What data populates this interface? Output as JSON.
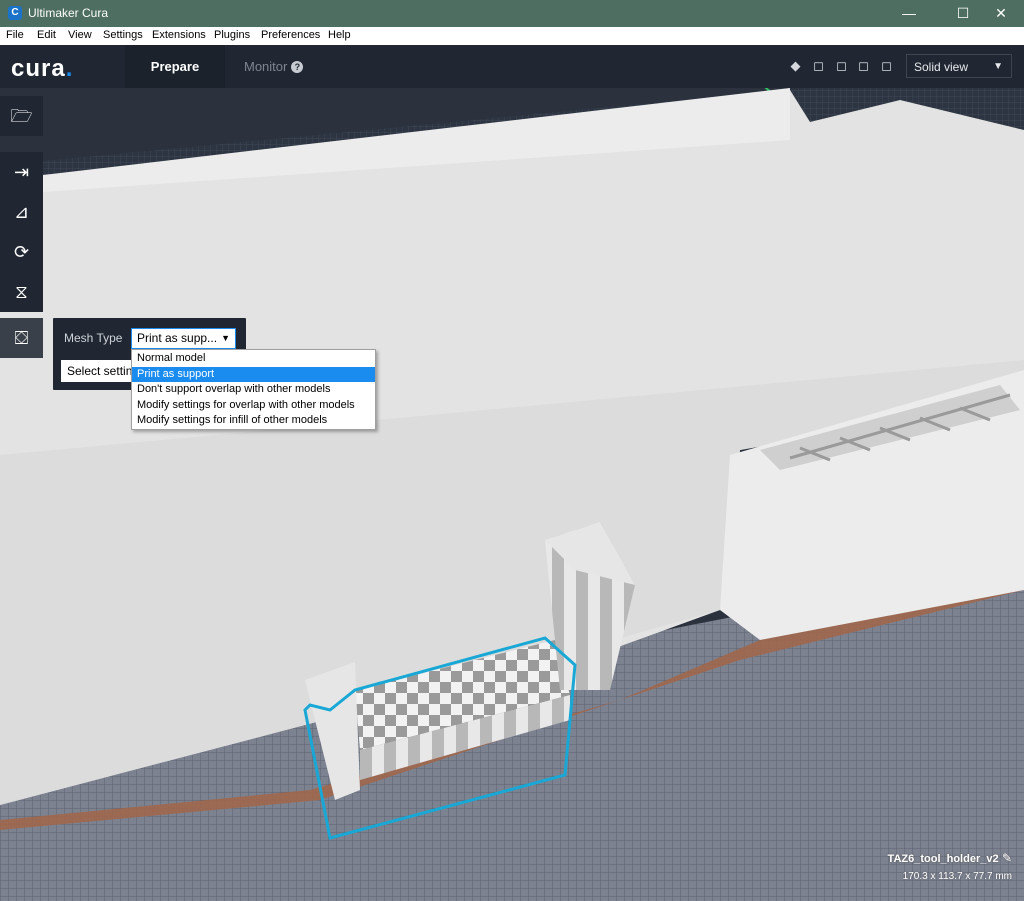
{
  "window": {
    "title": "Ultimaker Cura",
    "app_icon": "cura-app-icon",
    "minimize": "—",
    "maximize": "☐",
    "close": "✕"
  },
  "menu": [
    "File",
    "Edit",
    "View",
    "Settings",
    "Extensions",
    "Plugins",
    "Preferences",
    "Help"
  ],
  "header": {
    "logo": "cura",
    "logo_dot": ".",
    "tabs": [
      {
        "label": "Prepare",
        "active": true
      },
      {
        "label": "Monitor",
        "help_icon": "?"
      }
    ],
    "camera_icons": [
      "3d-view-icon",
      "front-view-icon",
      "top-view-icon",
      "left-view-icon",
      "right-view-icon"
    ],
    "view_mode": "Solid view"
  },
  "toolbar": {
    "items": [
      {
        "name": "open-file",
        "icon": "folder-open-icon"
      },
      {
        "name": "move",
        "icon": "move-tool-icon"
      },
      {
        "name": "scale",
        "icon": "scale-tool-icon"
      },
      {
        "name": "rotate",
        "icon": "rotate-tool-icon"
      },
      {
        "name": "mirror",
        "icon": "mirror-tool-icon"
      },
      {
        "name": "per-model-settings",
        "icon": "per-model-settings-icon",
        "active": true
      }
    ]
  },
  "per_model_panel": {
    "mesh_type_label": "Mesh Type",
    "mesh_type_value": "Print as supp...",
    "select_settings": "Select settings",
    "options": [
      "Normal model",
      "Print as support",
      "Don't support overlap with other models",
      "Modify settings for overlap with other models",
      "Modify settings for infill of other models"
    ],
    "selected_index": 1
  },
  "object_info": {
    "name": "TAZ6_tool_holder_v2",
    "dimensions": "170.3 x 113.7 x 77.7 mm"
  },
  "colors": {
    "accent": "#1a8cf0",
    "header_bg": "#202733",
    "titlebar": "#4d6e60",
    "selection_outline": "#19a8d6",
    "support_brown": "#a0674c",
    "model_gray": "#e0e0e0"
  }
}
